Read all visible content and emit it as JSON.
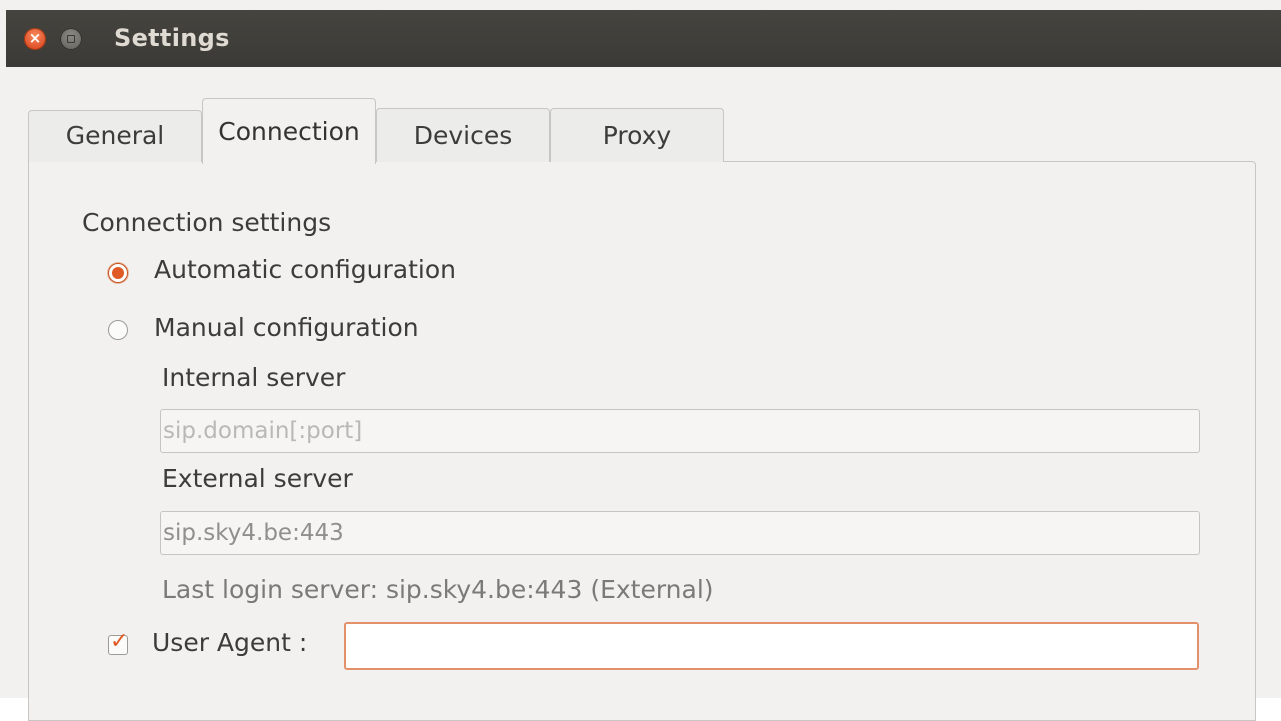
{
  "window": {
    "title": "Settings",
    "close_glyph": "×",
    "controls": [
      "close-icon",
      "minimize-icon"
    ]
  },
  "tabs": [
    {
      "label": "General",
      "active": false
    },
    {
      "label": "Connection",
      "active": true
    },
    {
      "label": "Devices",
      "active": false
    },
    {
      "label": "Proxy",
      "active": false
    }
  ],
  "connection": {
    "section_title": "Connection settings",
    "mode_options": [
      {
        "label": "Automatic configuration",
        "selected": true
      },
      {
        "label": "Manual configuration",
        "selected": false
      }
    ],
    "internal_server": {
      "label": "Internal server",
      "value": "",
      "placeholder": "sip.domain[:port]"
    },
    "external_server": {
      "label": "External server",
      "value": "sip.sky4.be:443"
    },
    "last_login": "Last login server: sip.sky4.be:443 (External)",
    "user_agent": {
      "label": "User Agent :",
      "checked": true,
      "check_glyph": "✓",
      "value": ""
    }
  },
  "colors": {
    "accent": "#e05a25",
    "titlebar": "#3c3b37",
    "window_bg": "#f2f1f0"
  }
}
